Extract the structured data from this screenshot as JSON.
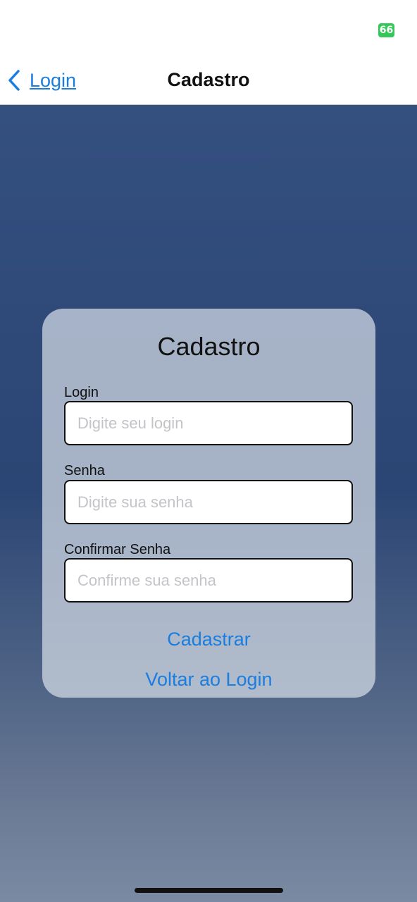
{
  "status_bar": {
    "battery_level": "66",
    "battery_color": "#34c759"
  },
  "nav": {
    "back_label": "Login",
    "back_icon": "chevron-left-icon",
    "title": "Cadastro"
  },
  "form": {
    "title": "Cadastro",
    "fields": [
      {
        "label": "Login",
        "placeholder": "Digite seu login",
        "value": ""
      },
      {
        "label": "Senha",
        "placeholder": "Digite sua senha",
        "value": ""
      },
      {
        "label": "Confirmar Senha",
        "placeholder": "Confirme sua senha",
        "value": ""
      }
    ],
    "submit_label": "Cadastrar",
    "back_to_login_label": "Voltar ao Login"
  },
  "colors": {
    "accent": "#1a7ee0",
    "background_top": "#34507f",
    "background_bottom": "#7a8aa3"
  }
}
